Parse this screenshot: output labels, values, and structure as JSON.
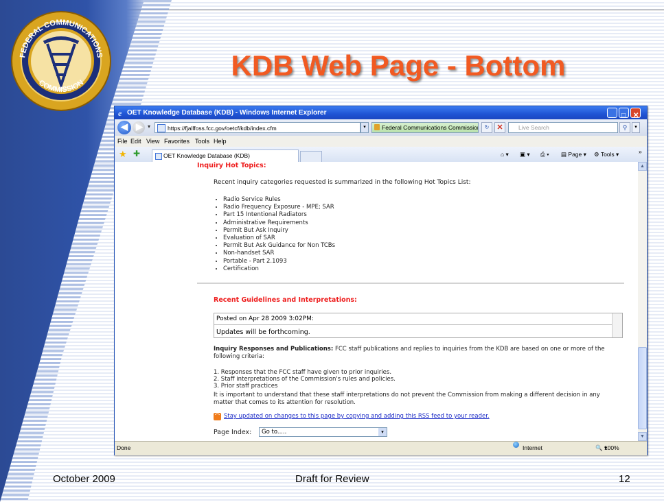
{
  "slide": {
    "title": "KDB Web Page - Bottom",
    "footer_date": "October 2009",
    "footer_draft": "Draft for Review",
    "footer_page": "12",
    "seal_text_top": "FEDERAL COMMUNICATIONS",
    "seal_text_bottom": "COMMISSION",
    "accent_color": "#f15a22"
  },
  "browser": {
    "window_title": "OET Knowledge Database (KDB) - Windows Internet Explorer",
    "address": "https://fjallfoss.fcc.gov/oetcf/kdb/index.cfm",
    "cert_label": "Federal Communications Commission [US]",
    "search_placeholder": "Live Search",
    "menu": [
      "File",
      "Edit",
      "View",
      "Favorites",
      "Tools",
      "Help"
    ],
    "tab_label": "OET Knowledge Database (KDB)",
    "cmd_page": "Page",
    "cmd_tools": "Tools",
    "cmd_more": "»",
    "status_left": "Done",
    "status_zone": "Internet",
    "status_zoom": "100%"
  },
  "page": {
    "hot_topics_heading": "Inquiry Hot Topics:",
    "hot_topics_intro": "Recent inquiry categories requested is summarized in the following Hot Topics List:",
    "hot_topics": [
      "Radio Service Rules",
      "Radio Frequency Exposure - MPE; SAR",
      "Part 15 Intentional Radiators",
      "Administrative Requirements",
      "Permit But Ask Inquiry",
      "Evaluation of SAR",
      "Permit But Ask Guidance for Non TCBs",
      "Non-handset SAR",
      "Portable - Part 2.1093",
      "Certification"
    ],
    "guidelines_heading": "Recent Guidelines and Interpretations:",
    "posted_on": "Posted on Apr 28 2009 3:02PM:",
    "updates_text": "Updates will be forthcoming.",
    "responses_bold": "Inquiry Responses and Publications:",
    "responses_line1": " FCC staff publications and replies to inquiries from the KDB are based on one or more of the",
    "responses_line2": "following criteria:",
    "criteria": [
      "1. Responses that the FCC staff have given to prior inquiries.",
      "2. Staff interpretations of the Commission's rules and policies.",
      "3. Prior staff practices"
    ],
    "important_line1": "It is important to understand that these staff interpretations do not prevent the Commission from making a different decision in any",
    "important_line2": "matter that comes to its attention for resolution.",
    "rss_link": "Stay updated on changes to this page by copying and adding this RSS feed to your reader.",
    "page_index_label": "Page Index:",
    "page_index_value": "Go to....."
  }
}
